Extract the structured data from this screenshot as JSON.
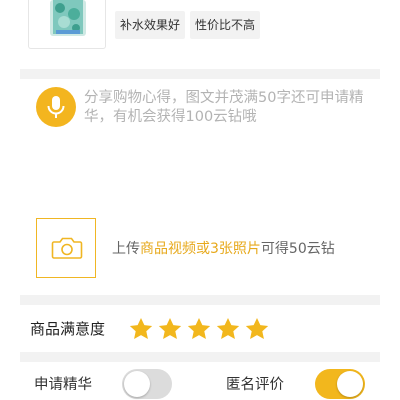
{
  "product": {
    "thumbnail_icon": "product-thumbnail-image",
    "tags": [
      {
        "label": "补水效果好"
      },
      {
        "label": "性价比不高"
      }
    ]
  },
  "review": {
    "mic_icon": "microphone-icon",
    "placeholder": "分享购物心得，图文并茂满50字还可申请精华，有机会获得100云钻哦"
  },
  "upload": {
    "camera_icon": "camera-icon",
    "text_prefix": "上传",
    "text_highlight": "商品视频或3张照片",
    "text_suffix": "可得50云钻"
  },
  "satisfaction": {
    "label": "商品满意度",
    "rating": 5,
    "max_rating": 5
  },
  "options": {
    "essence_label": "申请精华",
    "essence_enabled": false,
    "anonymous_label": "匿名评价",
    "anonymous_enabled": true
  },
  "colors": {
    "accent": "#f2b71d",
    "highlight_text": "#e7a91c",
    "toggle_off": "#dcdcdc",
    "divider": "#f2f2f2"
  }
}
